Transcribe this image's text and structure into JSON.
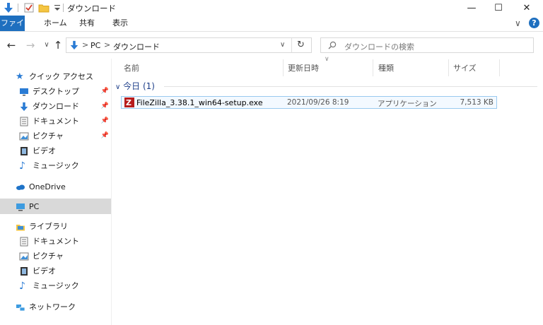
{
  "window": {
    "title": "ダウンロード"
  },
  "window_controls": {
    "minimize": "—",
    "maximize": "☐",
    "close": "✕"
  },
  "ribbon": {
    "tabs": [
      "ファイル",
      "ホーム",
      "共有",
      "表示"
    ],
    "expand_glyph": "∨",
    "help_glyph": "?"
  },
  "address": {
    "crumbs": [
      "PC",
      "ダウンロード"
    ],
    "separator": ">"
  },
  "search": {
    "placeholder": "ダウンロードの検索"
  },
  "nav": {
    "quick_access": "クイック アクセス",
    "quick_items": [
      {
        "label": "デスクトップ",
        "icon": "desktop-icon",
        "pinned": true
      },
      {
        "label": "ダウンロード",
        "icon": "download-icon",
        "pinned": true
      },
      {
        "label": "ドキュメント",
        "icon": "document-icon",
        "pinned": true
      },
      {
        "label": "ピクチャ",
        "icon": "pictures-icon",
        "pinned": true
      },
      {
        "label": "ビデオ",
        "icon": "video-icon",
        "pinned": false
      },
      {
        "label": "ミュージック",
        "icon": "music-icon",
        "pinned": false
      }
    ],
    "onedrive": "OneDrive",
    "pc": "PC",
    "library": "ライブラリ",
    "library_items": [
      {
        "label": "ドキュメント",
        "icon": "document-icon"
      },
      {
        "label": "ピクチャ",
        "icon": "pictures-icon"
      },
      {
        "label": "ビデオ",
        "icon": "video-icon"
      },
      {
        "label": "ミュージック",
        "icon": "music-icon"
      }
    ],
    "network": "ネットワーク"
  },
  "columns": {
    "name": "名前",
    "date": "更新日時",
    "type": "種類",
    "size": "サイズ"
  },
  "group": {
    "label": "今日 (1)"
  },
  "files": [
    {
      "name": "FileZilla_3.38.1_win64-setup.exe",
      "date": "2021/09/26 8:19",
      "type": "アプリケーション",
      "size": "7,513 KB"
    }
  ],
  "colors": {
    "accent": "#1e6fbf",
    "selected_nav": "#d9d9d9",
    "file_row_border": "#99c9ef",
    "file_row_bg": "#e5f3ff",
    "group_label": "#1e3f8a"
  }
}
